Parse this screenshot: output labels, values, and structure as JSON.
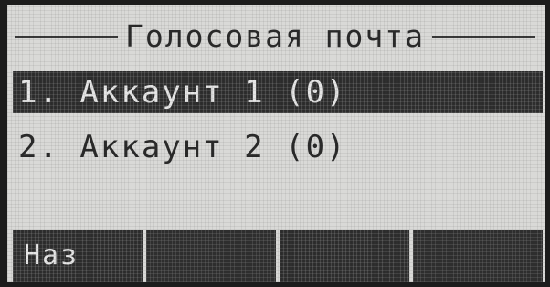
{
  "screen": {
    "title": "Голосовая почта"
  },
  "menu": {
    "items": [
      {
        "label": "1. Аккаунт 1 (0)",
        "selected": true
      },
      {
        "label": "2. Аккаунт 2 (0)",
        "selected": false
      }
    ]
  },
  "softkeys": [
    {
      "label": "Наз"
    },
    {
      "label": ""
    },
    {
      "label": ""
    },
    {
      "label": ""
    }
  ],
  "colors": {
    "lcd_background": "#d9d9d7",
    "highlight": "#2e2e2e"
  }
}
